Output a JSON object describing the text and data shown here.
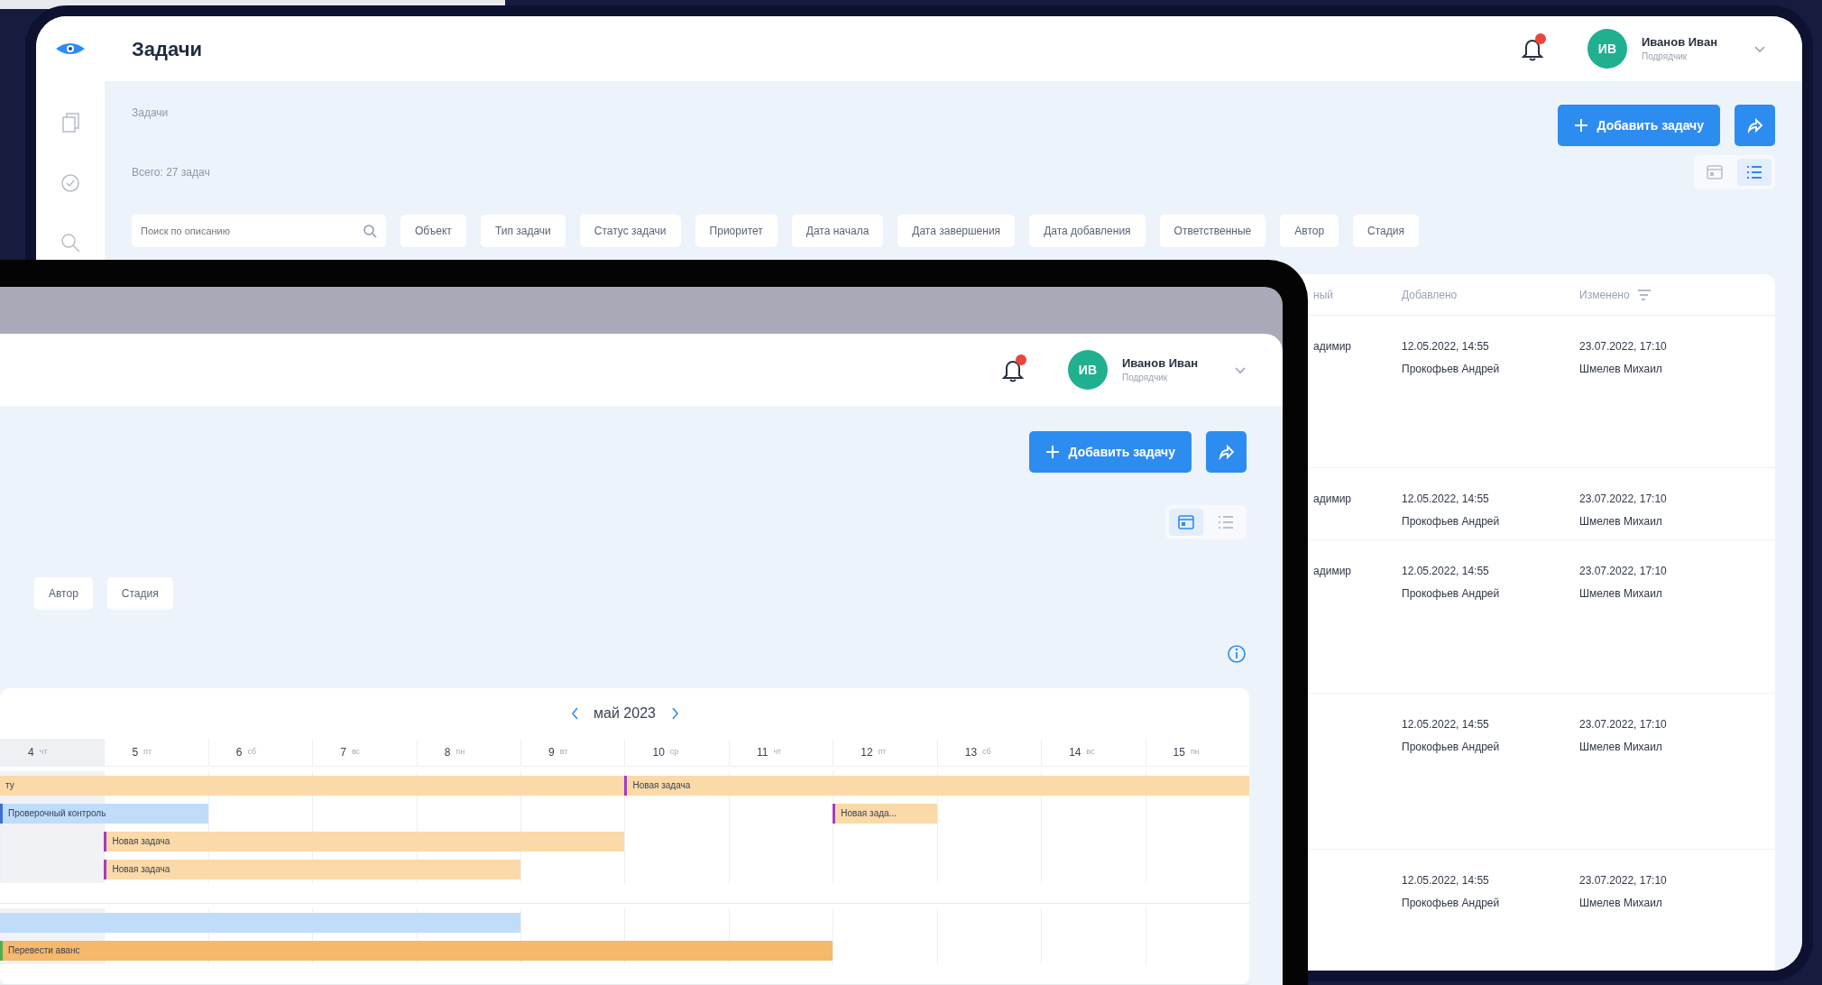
{
  "back_window": {
    "header": {
      "title": "Задачи",
      "notification": true,
      "user": {
        "initials": "ИВ",
        "name": "Иванов Иван",
        "role": "Подрядчик"
      }
    },
    "breadcrumb": "Задачи",
    "add_button": "Добавить задачу",
    "total": "Всего: 27 задач",
    "view_toggle": [
      {
        "kind": "calendar",
        "selected": false
      },
      {
        "kind": "list",
        "selected": true
      }
    ],
    "search": {
      "placeholder": "Поиск по описанию"
    },
    "filters": [
      "Объект",
      "Тип задачи",
      "Статус задачи",
      "Приоритет",
      "Дата начала",
      "Дата завершения",
      "Дата добавления",
      "Ответственные",
      "Автор",
      "Стадия"
    ],
    "table": {
      "columns": [
        "ный",
        "Добавлено",
        "Изменено"
      ],
      "rows": [
        {
          "column_1": "адимир",
          "added": [
            "12.05.2022, 14:55",
            "Прокофьев Андрей"
          ],
          "changed": [
            "23.07.2022, 17:10",
            "Шмелев Михаил"
          ]
        },
        {
          "column_1": "адимир",
          "added": [
            "12.05.2022, 14:55",
            "Прокофьев Андрей"
          ],
          "changed": [
            "23.07.2022, 17:10",
            "Шмелев Михаил"
          ]
        },
        {
          "column_1": "адимир",
          "added": [
            "12.05.2022, 14:55",
            "Прокофьев Андрей"
          ],
          "changed": [
            "23.07.2022, 17:10",
            "Шмелев Михаил"
          ]
        },
        {
          "added": [
            "12.05.2022, 14:55",
            "Прокофьев Андрей"
          ],
          "changed": [
            "23.07.2022, 17:10",
            "Шмелев Михаил"
          ]
        },
        {
          "added": [
            "12.05.2022, 14:55",
            "Прокофьев Андрей"
          ],
          "changed": [
            "23.07.2022, 17:10",
            "Шмелев Михаил"
          ]
        }
      ]
    }
  },
  "front_window": {
    "header": {
      "notification": true,
      "user": {
        "initials": "ИВ",
        "name": "Иванов Иван",
        "role": "Подрядчик"
      }
    },
    "add_button": "Добавить задачу",
    "view_toggle": [
      {
        "kind": "calendar",
        "selected": true
      },
      {
        "kind": "list",
        "selected": false
      }
    ],
    "filters": [
      "Автор",
      "Стадия"
    ],
    "calendar": {
      "month": "май 2023",
      "days": [
        {
          "day": "4",
          "weekday": "чт",
          "today": true
        },
        {
          "day": "5",
          "weekday": "пт",
          "today": false
        },
        {
          "day": "6",
          "weekday": "сб",
          "today": false
        },
        {
          "day": "7",
          "weekday": "вс",
          "today": false
        },
        {
          "day": "8",
          "weekday": "пн",
          "today": false
        },
        {
          "day": "9",
          "weekday": "вт",
          "today": false
        },
        {
          "day": "10",
          "weekday": "ср",
          "today": false
        },
        {
          "day": "11",
          "weekday": "чт",
          "today": false
        },
        {
          "day": "12",
          "weekday": "пт",
          "today": false
        },
        {
          "day": "13",
          "weekday": "сб",
          "today": false
        },
        {
          "day": "14",
          "weekday": "вс",
          "today": false
        },
        {
          "day": "15",
          "weekday": "пн",
          "today": false
        }
      ],
      "groups": [
        {
          "lanes": [
            [
              {
                "kind": "task",
                "label": "ту"
              },
              {
                "kind": "cont"
              },
              {
                "kind": "cont"
              },
              {
                "kind": "cont"
              },
              {
                "kind": "cont"
              },
              {
                "kind": "cont"
              },
              {
                "kind": "task",
                "label": "Новая задача",
                "color": "#a63cbf"
              },
              {
                "kind": "cont"
              },
              {
                "kind": "cont"
              },
              {
                "kind": "cont"
              },
              {
                "kind": "cont"
              },
              {
                "kind": "cont"
              }
            ],
            [
              {
                "kind": "inspection",
                "label": "Проверочный контроль",
                "color": "#3b6fd6"
              },
              {
                "kind": "cont"
              },
              {
                "kind": "empty"
              },
              {
                "kind": "empty"
              },
              {
                "kind": "empty"
              },
              {
                "kind": "empty"
              },
              {
                "kind": "empty"
              },
              {
                "kind": "empty"
              },
              {
                "kind": "task",
                "label": "Новая зада...",
                "color": "#a63cbf"
              },
              {
                "kind": "empty"
              },
              {
                "kind": "empty"
              },
              {
                "kind": "empty"
              }
            ],
            [
              {
                "kind": "empty"
              },
              {
                "kind": "task",
                "label": "Новая задача",
                "color": "#a63cbf"
              },
              {
                "kind": "cont"
              },
              {
                "kind": "cont"
              },
              {
                "kind": "cont"
              },
              {
                "kind": "cont"
              },
              {
                "kind": "empty"
              },
              {
                "kind": "empty"
              },
              {
                "kind": "empty"
              },
              {
                "kind": "empty"
              },
              {
                "kind": "empty"
              },
              {
                "kind": "empty"
              }
            ],
            [
              {
                "kind": "empty"
              },
              {
                "kind": "task",
                "label": "Новая задача",
                "color": "#a63cbf"
              },
              {
                "kind": "cont"
              },
              {
                "kind": "cont"
              },
              {
                "kind": "cont"
              },
              {
                "kind": "empty"
              },
              {
                "kind": "empty"
              },
              {
                "kind": "empty"
              },
              {
                "kind": "empty"
              },
              {
                "kind": "empty"
              },
              {
                "kind": "empty"
              },
              {
                "kind": "empty"
              }
            ]
          ]
        },
        {
          "lanes": [
            [
              {
                "kind": "inspection"
              },
              {
                "kind": "cont"
              },
              {
                "kind": "cont"
              },
              {
                "kind": "cont"
              },
              {
                "kind": "cont"
              },
              {
                "kind": "empty"
              },
              {
                "kind": "empty"
              },
              {
                "kind": "empty"
              },
              {
                "kind": "empty"
              },
              {
                "kind": "empty"
              },
              {
                "kind": "empty"
              },
              {
                "kind": "empty"
              }
            ],
            [
              {
                "kind": "payment",
                "label": "Перевести аванс",
                "color": "#4caf50"
              },
              {
                "kind": "cont"
              },
              {
                "kind": "cont"
              },
              {
                "kind": "cont"
              },
              {
                "kind": "cont"
              },
              {
                "kind": "cont"
              },
              {
                "kind": "cont"
              },
              {
                "kind": "cont"
              },
              {
                "kind": "empty"
              },
              {
                "kind": "empty"
              },
              {
                "kind": "empty"
              },
              {
                "kind": "empty"
              }
            ]
          ]
        }
      ]
    }
  }
}
